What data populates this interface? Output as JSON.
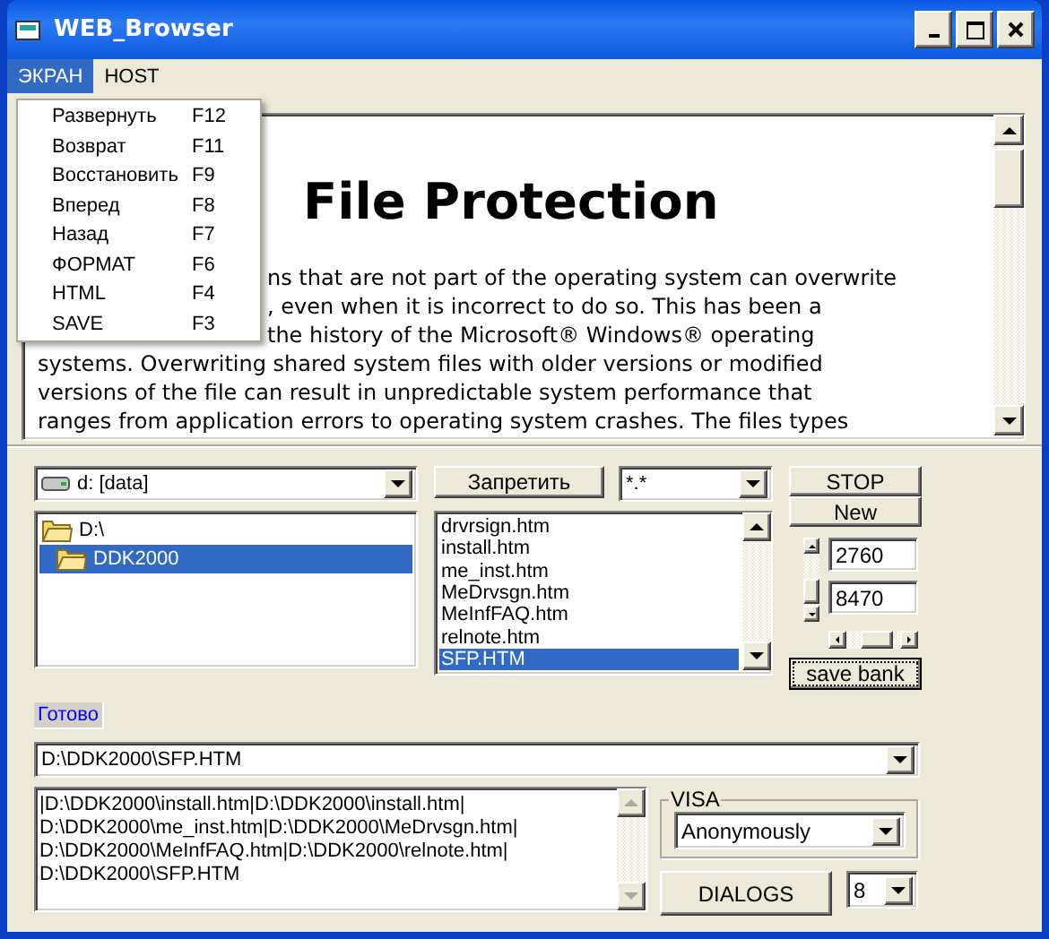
{
  "window": {
    "title": "WEB_Browser"
  },
  "menu_bar": [
    {
      "label": "ЭКРАН",
      "selected": true
    },
    {
      "label": "HOST",
      "selected": false
    }
  ],
  "menu": [
    {
      "label": "Развернуть",
      "shortcut": "F12"
    },
    {
      "label": "Возврат",
      "shortcut": "F11"
    },
    {
      "label": "Восстановить",
      "shortcut": "F9"
    },
    {
      "label": "Вперед",
      "shortcut": "F8"
    },
    {
      "label": "Назад",
      "shortcut": "F7"
    },
    {
      "label": "ФОРМАТ",
      "shortcut": "F6"
    },
    {
      "label": "HTML",
      "shortcut": "F4"
    },
    {
      "label": "SAVE",
      "shortcut": "F3"
    }
  ],
  "browser": {
    "heading": "File Protection",
    "lines_beside_menu": [
      "ns that are not part of the operating system can overwrite",
      ", even when it is incorrect to do so. This has been a",
      "the history of the Microsoft® Windows® operating"
    ],
    "lines": [
      "systems. Overwriting shared system files with older versions or modified",
      "versions of the file can result in unpredictable system performance that",
      "ranges from application errors to operating system crashes. The files types"
    ]
  },
  "drive": {
    "value": "d: [data]"
  },
  "folders": [
    {
      "name": "D:\\",
      "selected": false,
      "children": [
        {
          "name": "DDK2000",
          "selected": true
        }
      ]
    }
  ],
  "block_button": "Запретить",
  "filter": {
    "value": "*.*"
  },
  "files": [
    {
      "name": "drvrsign.htm",
      "selected": false
    },
    {
      "name": "install.htm",
      "selected": false
    },
    {
      "name": "me_inst.htm",
      "selected": false
    },
    {
      "name": "MeDrvsgn.htm",
      "selected": false
    },
    {
      "name": "MeInfFAQ.htm",
      "selected": false
    },
    {
      "name": "relnote.htm",
      "selected": false
    },
    {
      "name": "SFP.HTM",
      "selected": true
    }
  ],
  "stop_button": "STOP",
  "new_button": "New",
  "fields": [
    "2760",
    "8470"
  ],
  "save_button": {
    "label": "save bank",
    "focused": true
  },
  "status": "Готово",
  "path": {
    "value": "D:\\DDK2000\\SFP.HTM"
  },
  "log": [
    "|D:\\DDK2000\\install.htm|D:\\DDK2000\\install.htm|",
    "D:\\DDK2000\\me_inst.htm|D:\\DDK2000\\MeDrvsgn.htm|",
    "D:\\DDK2000\\MeInfFAQ.htm|D:\\DDK2000\\relnote.htm|",
    "D:\\DDK2000\\SFP.HTM"
  ],
  "visa": {
    "label": "VISA",
    "value": "Anonymously"
  },
  "dialogs_button": "DIALOGS",
  "count": {
    "value": "8"
  }
}
